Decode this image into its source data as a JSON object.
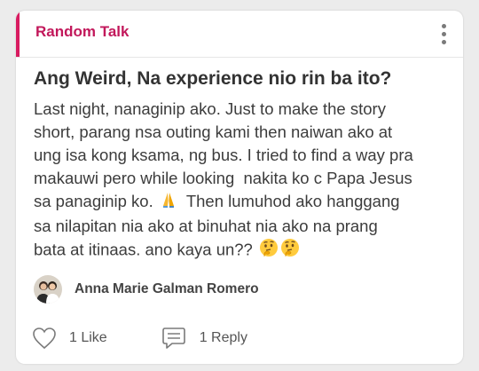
{
  "post": {
    "category": "Random Talk",
    "title": "Ang Weird, Na experience nio rin ba ito?",
    "body_lines": [
      "Last night, nanaginip ako. Just to make the story",
      "short, parang nsa outing kami then naiwan ako at",
      "ung isa kong ksama, ng bus. I tried to find a way pra",
      "makauwi pero while looking  nakita ko c Papa Jesus",
      "sa panaginip ko.",
      "  Then lumuhod ako hanggang",
      "sa nilapitan nia ako at binuhat nia ako na prang",
      "bata at itinaas. ano kaya un??"
    ],
    "author": "Anna Marie Galman Romero",
    "likes_label": "1 Like",
    "replies_label": "1 Reply"
  },
  "icons": {
    "more": "vertical-ellipsis-icon",
    "like": "heart-outline-icon",
    "reply": "chat-bubble-icon",
    "emoji_pray": "folded-hands-emoji",
    "emoji_thinking": "thinking-face-emoji"
  },
  "colors": {
    "accent": "#d81b60",
    "category_text": "#c2185b",
    "title_text": "#333333",
    "body_text": "#3c3c3c",
    "icon_gray": "#7a7a7a"
  }
}
